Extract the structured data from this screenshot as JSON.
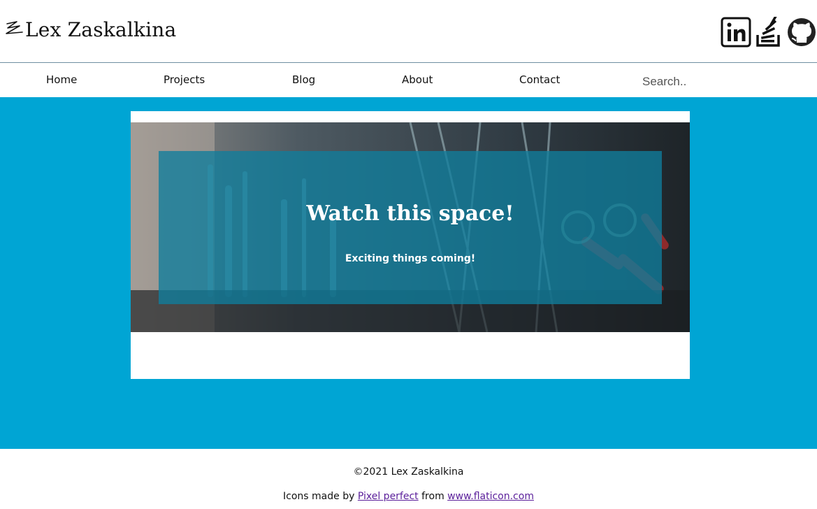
{
  "header": {
    "logo_text": "Lex Zaskalkina",
    "social": [
      {
        "icon": "linkedin-icon"
      },
      {
        "icon": "stackoverflow-icon"
      },
      {
        "icon": "github-icon"
      }
    ]
  },
  "nav": {
    "items": [
      {
        "label": "Home"
      },
      {
        "label": "Projects"
      },
      {
        "label": "Blog"
      },
      {
        "label": "About"
      },
      {
        "label": "Contact"
      }
    ],
    "search": {
      "placeholder": "Search.."
    }
  },
  "hero": {
    "title": "Watch this space!",
    "subtitle": "Exciting things coming!"
  },
  "footer": {
    "copyright": "©2021 Lex Zaskalkina",
    "credits_prefix": "Icons made by",
    "credits_author": "Pixel perfect",
    "credits_from": "from",
    "credits_site": "www.flaticon.com"
  },
  "colors": {
    "accent": "#00a5d4",
    "panel_overlay": "#107e9c",
    "link": "#5a1e9a",
    "header_divider": "#6f8fa1"
  }
}
